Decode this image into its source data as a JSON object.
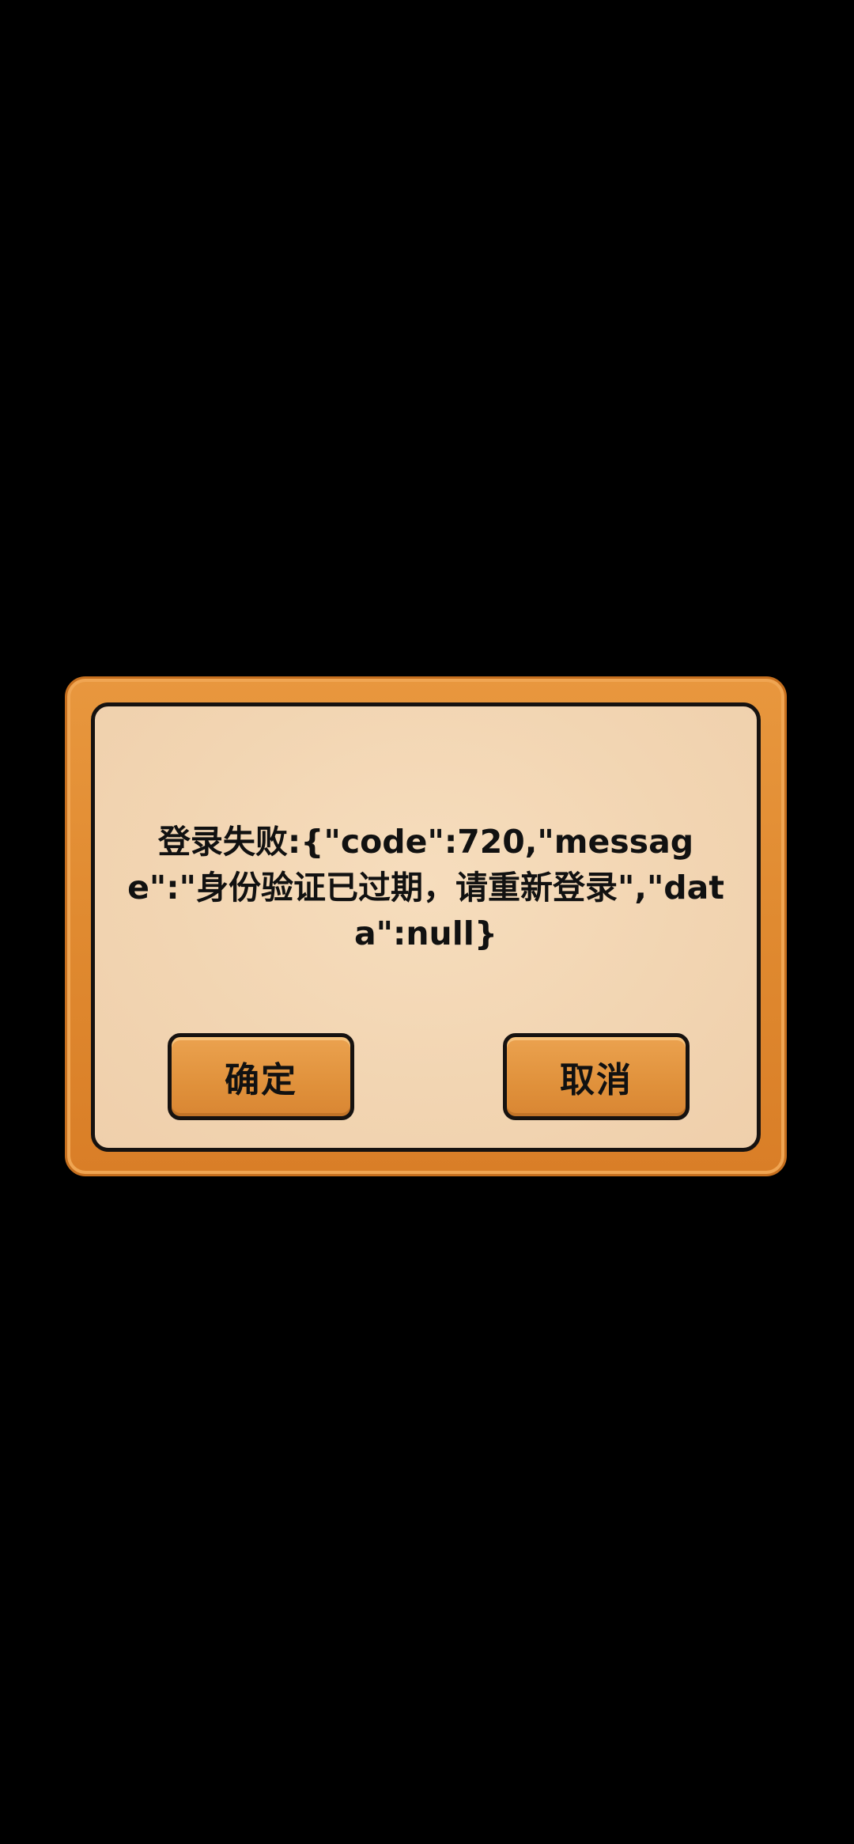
{
  "dialog": {
    "message": "登录失败:{\"code\":720,\"message\":\"身份验证已过期，请重新登录\",\"data\":null}",
    "confirm_label": "确定",
    "cancel_label": "取消"
  },
  "colors": {
    "background": "#000000",
    "frame_orange": "#e08a30",
    "panel_cream": "#f2d5b2",
    "button_orange": "#e0913b",
    "outline": "#161210",
    "text": "#111111"
  }
}
